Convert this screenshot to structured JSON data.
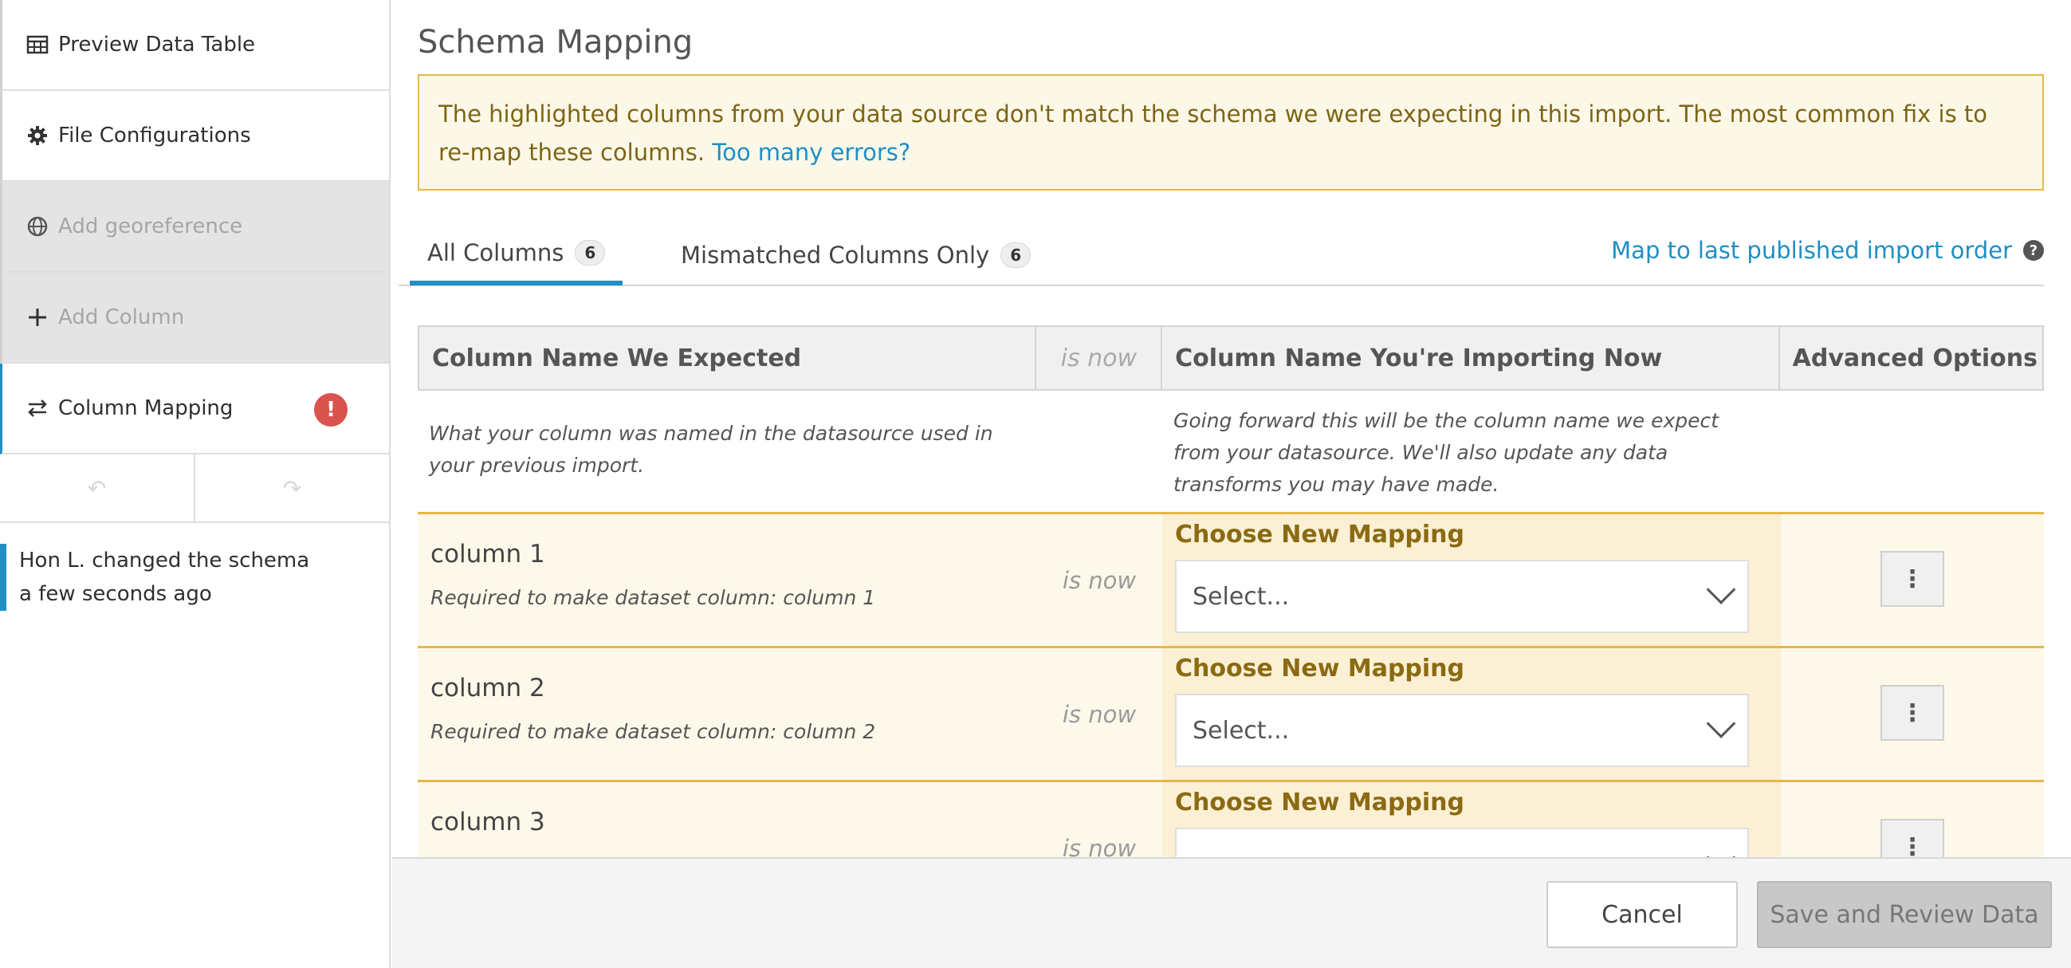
{
  "sidebar": {
    "items": [
      {
        "label": "Preview Data Table",
        "icon": "table-icon"
      },
      {
        "label": "File Configurations",
        "icon": "gear-icon"
      },
      {
        "label": "Add georeference",
        "icon": "globe-icon"
      },
      {
        "label": "Add Column",
        "icon": "plus-icon"
      },
      {
        "label": "Column Mapping",
        "icon": "swap-arrows-icon",
        "badge": "!"
      }
    ],
    "undo_icon": "↶",
    "redo_icon": "↷",
    "activity": {
      "line1": "Hon L. changed the schema",
      "line2": "a few seconds ago"
    }
  },
  "main": {
    "title": "Schema Mapping",
    "alert": {
      "text": "The highlighted columns from your data source don't match the schema we were expecting in this import. The most common fix is to re-map these columns.",
      "link": "Too many errors?"
    },
    "tabs": [
      {
        "label": "All Columns",
        "count": "6"
      },
      {
        "label": "Mismatched Columns Only",
        "count": "6"
      }
    ],
    "map_link": "Map to last published import order",
    "help": "?",
    "table": {
      "headers": [
        "Column Name We Expected",
        "is now",
        "Column Name You're Importing Now",
        "Advanced Options"
      ],
      "desc_left": "What your column was named in the datasource used in your previous import.",
      "desc_right": "Going forward this will be the column name we expect from your datasource. We'll also update any data transforms you may have made.",
      "rows": [
        {
          "name": "column 1",
          "req": "Required to make dataset column: column 1",
          "is_now": "is now",
          "choose": "Choose New Mapping",
          "select": "Select..."
        },
        {
          "name": "column 2",
          "req": "Required to make dataset column: column 2",
          "is_now": "is now",
          "choose": "Choose New Mapping",
          "select": "Select..."
        },
        {
          "name": "column 3",
          "req": "",
          "is_now": "is now",
          "choose": "Choose New Mapping",
          "select": ""
        }
      ]
    }
  },
  "footer": {
    "cancel": "Cancel",
    "save": "Save and Review Data"
  },
  "colors": {
    "accent": "#1f8fc4",
    "warning_border": "#e8b74a",
    "error": "#d9534f"
  }
}
